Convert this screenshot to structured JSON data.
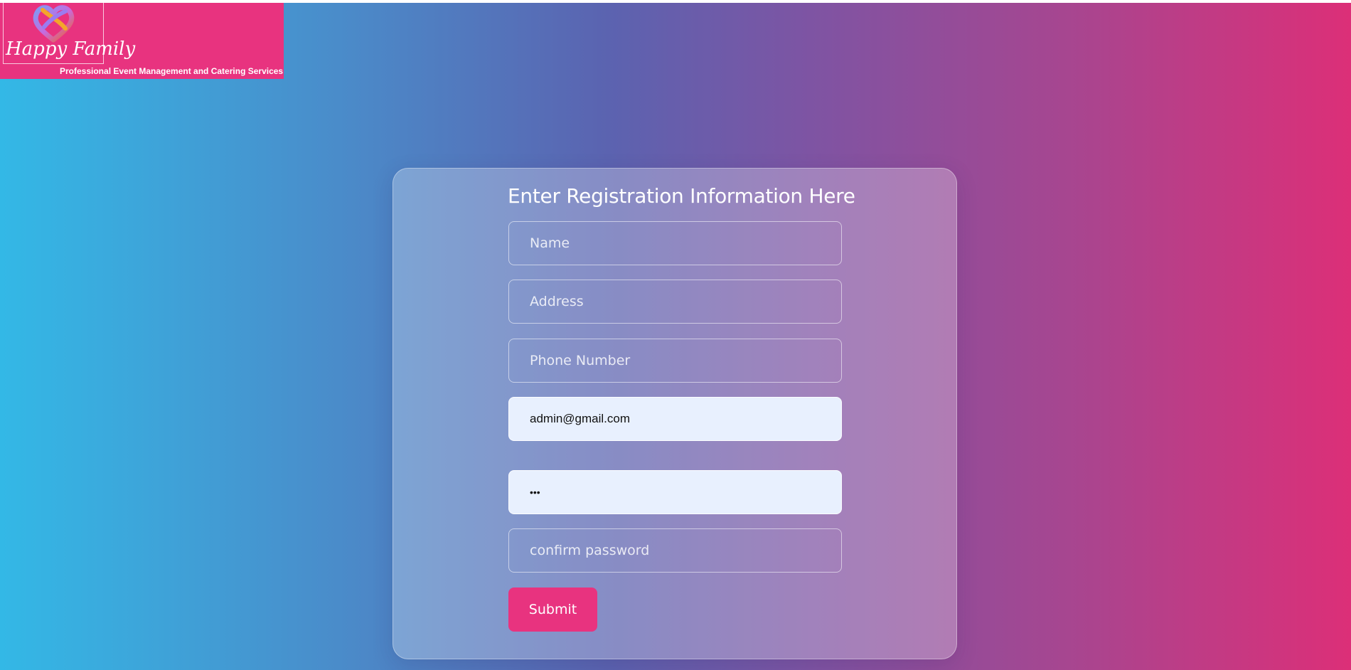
{
  "brand": {
    "name": "Happy Family",
    "tagline": "Professional Event Management and Catering Services"
  },
  "form": {
    "title": "Enter Registration Information Here",
    "name_placeholder": "Name",
    "address_placeholder": "Address",
    "phone_placeholder": "Phone Number",
    "email_value": "admin@gmail.com",
    "password_value": "•••",
    "confirm_placeholder": "confirm password",
    "submit_label": "Submit"
  },
  "colors": {
    "brand_pink": "#e8337f",
    "autofill_bg": "#e8f0fe"
  }
}
